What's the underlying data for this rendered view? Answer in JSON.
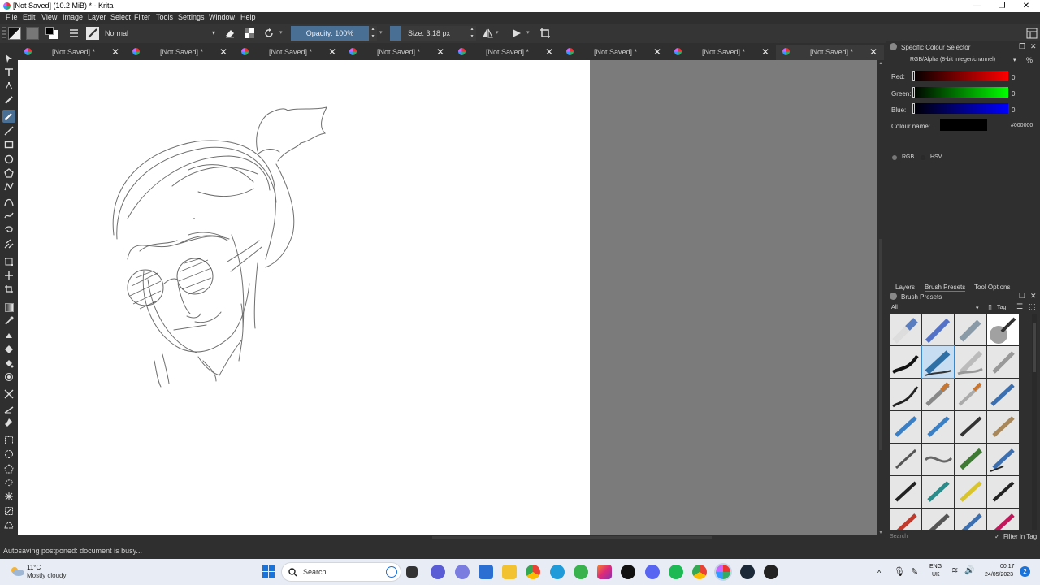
{
  "window": {
    "title": "[Not Saved]  (10.2 MiB)  * - Krita",
    "controls": [
      "—",
      "❐",
      "✕"
    ]
  },
  "menu": [
    "File",
    "Edit",
    "View",
    "Image",
    "Layer",
    "Select",
    "Filter",
    "Tools",
    "Settings",
    "Window",
    "Help"
  ],
  "toolbar": {
    "blend_mode": "Normal",
    "opacity_label": "Opacity: 100%",
    "opacity_value": 1.0,
    "size_label": "Size: 3.18 px"
  },
  "tabs": [
    {
      "label": "[Not Saved]  *",
      "active": false
    },
    {
      "label": "[Not Saved]  *",
      "active": false
    },
    {
      "label": "[Not Saved]  *",
      "active": false
    },
    {
      "label": "[Not Saved]  *",
      "active": false
    },
    {
      "label": "[Not Saved]  *",
      "active": false
    },
    {
      "label": "[Not Saved]  *",
      "active": false
    },
    {
      "label": "[Not Saved]  *",
      "active": false
    },
    {
      "label": "[Not Saved]  *",
      "active": true
    }
  ],
  "color_selector": {
    "title": "Specific Colour Selector",
    "model": "RGB/Alpha (8-bit integer/channel)",
    "channels": [
      {
        "label": "Red:",
        "value": "0",
        "color": "#ff0000"
      },
      {
        "label": "Green:",
        "value": "0",
        "color": "#00ff00"
      },
      {
        "label": "Blue:",
        "value": "0",
        "color": "#0000ff"
      }
    ],
    "colour_name_label": "Colour name:",
    "hex": "#000000",
    "modes": [
      "RGB",
      "HSV"
    ],
    "selected_mode": "RGB"
  },
  "docker_tabs": [
    "Layers",
    "Brush Presets",
    "Tool Options"
  ],
  "active_docker_tab": "Brush Presets",
  "brush_presets": {
    "title": "Brush Presets",
    "filter": "All",
    "tag_label": "Tag",
    "search_placeholder": "Search",
    "filter_in_tag": "Filter in Tag",
    "selected_index": 5
  },
  "status": {
    "message": "Autosaving postponed: document is busy..."
  },
  "taskbar": {
    "temperature": "11°C",
    "condition": "Mostly cloudy",
    "search_label": "Search",
    "language": "ENG",
    "region": "UK",
    "time": "00:17",
    "date": "24/05/2023",
    "notifications": "2"
  }
}
